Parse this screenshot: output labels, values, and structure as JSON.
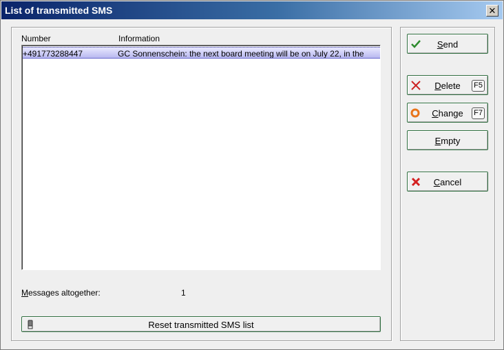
{
  "window": {
    "title": "List of transmitted SMS",
    "close_label": "✕"
  },
  "list": {
    "headers": {
      "number": "Number",
      "information": "Information"
    },
    "rows": [
      {
        "number": "+491773288447",
        "information": "GC Sonnenschein: the next board meeting will be on July 22, in the"
      }
    ]
  },
  "summary": {
    "label_first": "M",
    "label_rest": "essages altogether:",
    "count": "1"
  },
  "reset_button": {
    "label": "Reset transmitted SMS list",
    "icon": "eraser-icon"
  },
  "buttons": {
    "send": {
      "first": "S",
      "rest": "end",
      "icon": "checkmark-icon"
    },
    "delete": {
      "first": "D",
      "rest": "elete",
      "key": "F5",
      "icon": "x-mark-icon"
    },
    "change": {
      "first": "C",
      "rest": "hange",
      "key": "F7",
      "icon": "ring-icon"
    },
    "empty": {
      "first": "E",
      "rest": "mpty"
    },
    "cancel": {
      "first": "C",
      "rest": "ancel",
      "icon": "cancel-x-icon"
    }
  },
  "colors": {
    "title_start": "#0a246a",
    "selection": "#b8b8f0",
    "button_border": "#2f6e3f"
  }
}
